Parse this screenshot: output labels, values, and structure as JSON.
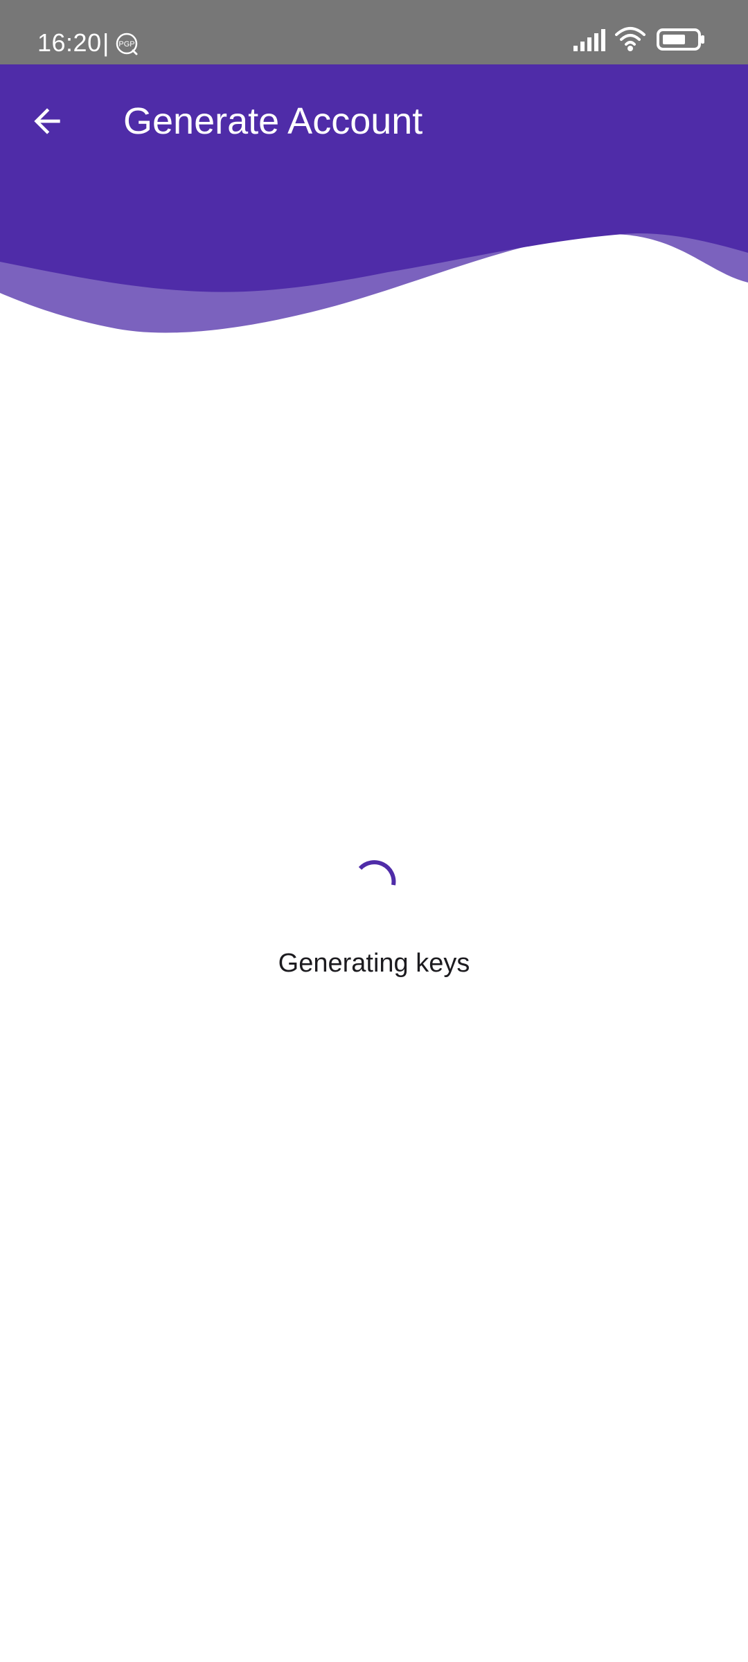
{
  "status_bar": {
    "time": "16:20",
    "separator": "|",
    "notification_icon": "pgp-icon",
    "icons": [
      "signal-icon",
      "wifi-icon",
      "battery-icon"
    ]
  },
  "app_bar": {
    "back_icon": "arrow-back-icon",
    "title": "Generate Account"
  },
  "content": {
    "loading_icon": "progress-spinner",
    "loading_text": "Generating keys"
  },
  "colors": {
    "status_bar": "#777777",
    "primary_dark": "#4F2CA8",
    "primary_light": "#7B62BE",
    "spinner": "#4F2CA8",
    "text": "#1c1b1f",
    "background": "#ffffff"
  }
}
